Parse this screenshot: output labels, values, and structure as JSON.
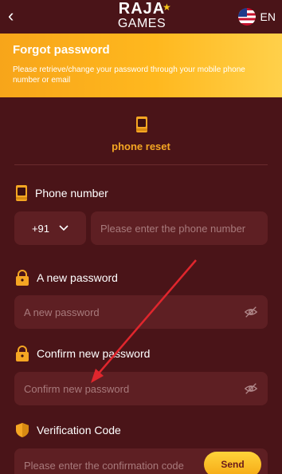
{
  "header": {
    "logo_top": "RAJA",
    "logo_bottom": "GAMES",
    "language": "EN"
  },
  "banner": {
    "title": "Forgot password",
    "description": "Please retrieve/change your password through your mobile phone number or email"
  },
  "tab": {
    "label": "phone reset",
    "icon": "phone-icon"
  },
  "phone": {
    "label": "Phone number",
    "country_code": "+91",
    "placeholder": "Please enter the phone number"
  },
  "new_password": {
    "label": "A new password",
    "placeholder": "A new password"
  },
  "confirm_password": {
    "label": "Confirm new password",
    "placeholder": "Confirm new password"
  },
  "verification": {
    "label": "Verification Code",
    "placeholder": "Please enter the confirmation code",
    "send_label": "Send"
  },
  "colors": {
    "background": "#4a1418",
    "banner": "#f7a51a",
    "accent": "#f5a623",
    "field": "#5e1f23",
    "annotation_arrow": "#e0262d"
  }
}
